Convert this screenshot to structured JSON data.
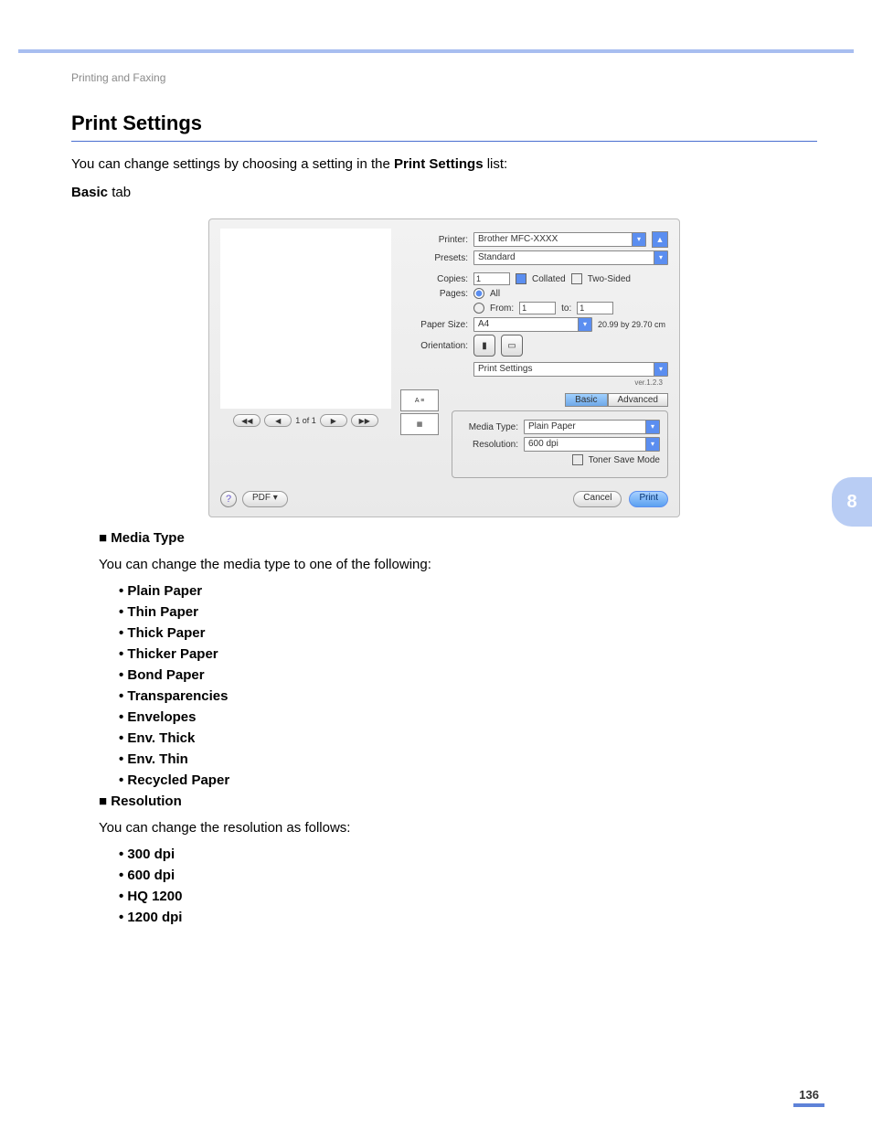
{
  "breadcrumb": "Printing and Faxing",
  "title": "Print Settings",
  "intro": {
    "pre": "You can change settings by choosing a setting in the ",
    "bold": "Print Settings",
    "post": " list:"
  },
  "basicTab": {
    "bold": "Basic",
    "rest": " tab"
  },
  "sideTab": "8",
  "pageNumber": "136",
  "dialog": {
    "pager": "1 of 1",
    "labels": {
      "printer": "Printer:",
      "presets": "Presets:",
      "copies": "Copies:",
      "collated": "Collated",
      "twoSided": "Two-Sided",
      "pages": "Pages:",
      "all": "All",
      "from": "From:",
      "to": "to:",
      "paperSize": "Paper Size:",
      "orientation": "Orientation:",
      "mediaType": "Media Type:",
      "resolution": "Resolution:",
      "tonerSave": "Toner Save Mode"
    },
    "values": {
      "printer": "Brother MFC-XXXX",
      "presets": "Standard",
      "copies": "1",
      "from": "1",
      "to": "1",
      "paperSize": "A4",
      "paperDim": "20.99 by 29.70 cm",
      "section": "Print Settings",
      "version": "ver.1.2.3",
      "mediaType": "Plain Paper",
      "resolution": "600 dpi"
    },
    "tabs": {
      "basic": "Basic",
      "advanced": "Advanced"
    },
    "buttons": {
      "pdf": "PDF ▾",
      "cancel": "Cancel",
      "print": "Print"
    }
  },
  "sections": {
    "mediaType": {
      "title": "Media Type",
      "desc": "You can change the media type to one of the following:",
      "items": [
        "Plain Paper",
        "Thin Paper",
        "Thick Paper",
        "Thicker Paper",
        "Bond Paper",
        "Transparencies",
        "Envelopes",
        "Env. Thick",
        "Env. Thin",
        "Recycled Paper"
      ]
    },
    "resolution": {
      "title": "Resolution",
      "desc": "You can change the resolution as follows:",
      "items": [
        "300 dpi",
        "600 dpi",
        "HQ 1200",
        "1200 dpi"
      ]
    }
  }
}
